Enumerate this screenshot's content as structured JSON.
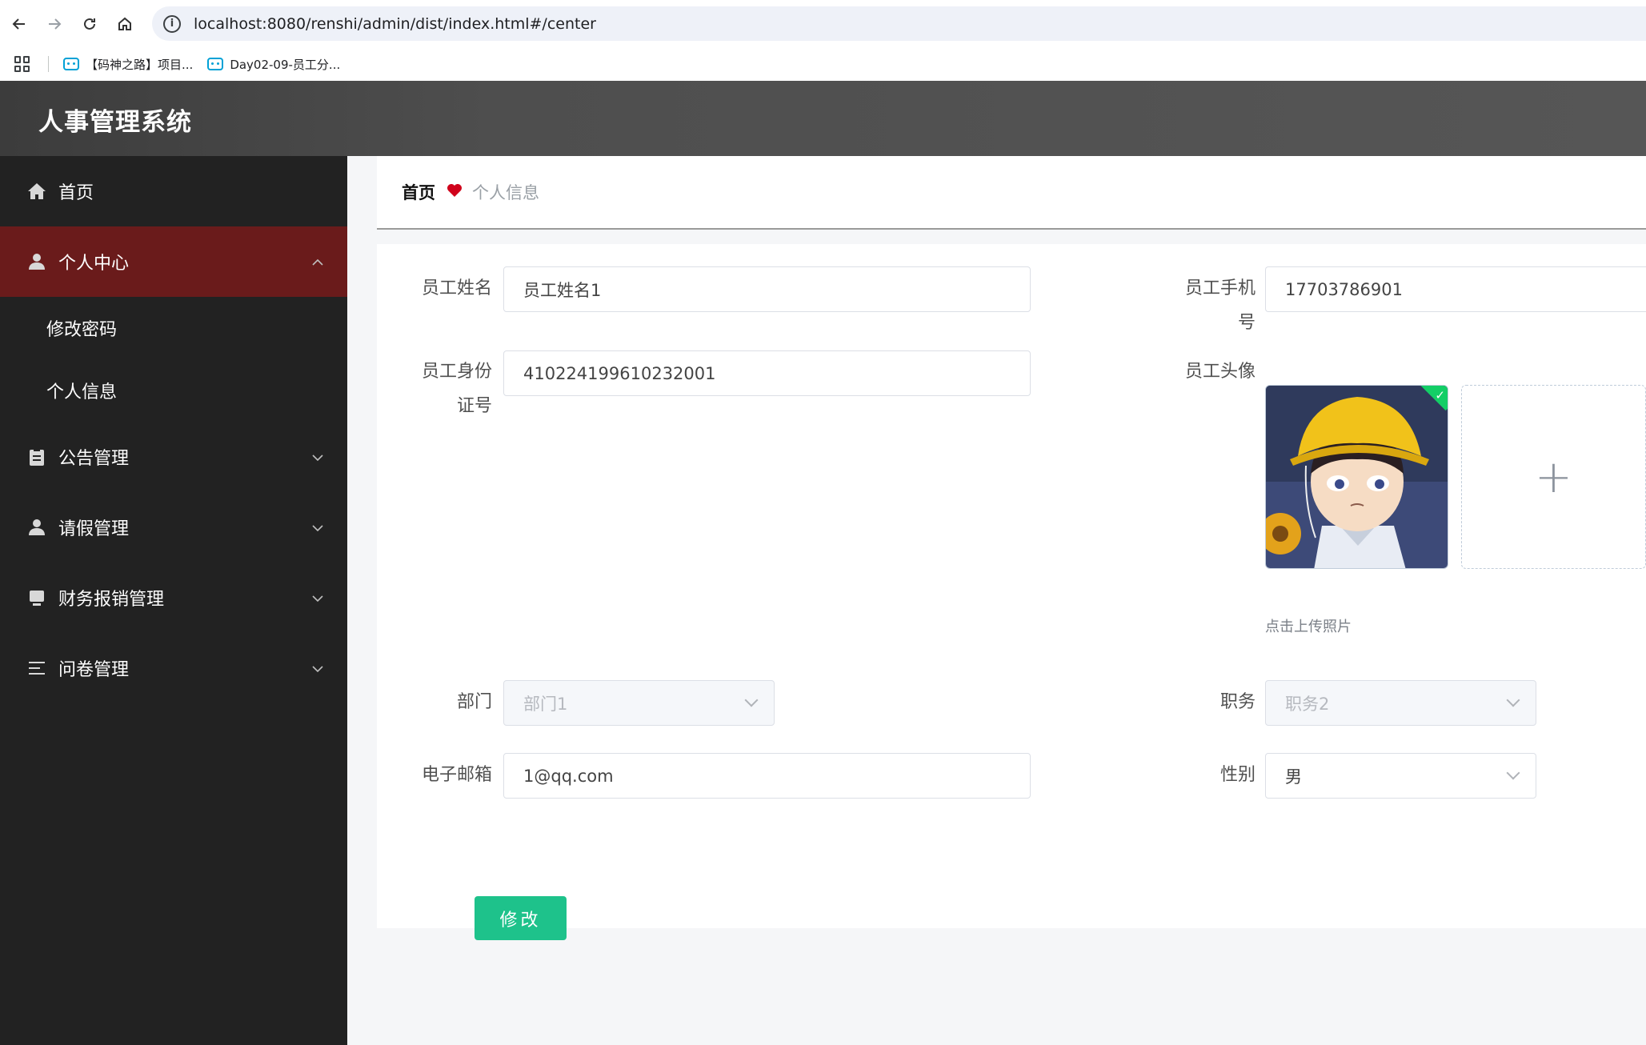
{
  "browser": {
    "url": "localhost:8080/renshi/admin/dist/index.html#/center",
    "bookmarks": [
      "【码神之路】项目...",
      "Day02-09-员工分..."
    ]
  },
  "app": {
    "title": "人事管理系统"
  },
  "sidebar": {
    "items": [
      {
        "label": "首页",
        "icon": "home-icon"
      },
      {
        "label": "个人中心",
        "icon": "user-icon",
        "expanded": true
      },
      {
        "label": "修改密码"
      },
      {
        "label": "个人信息"
      },
      {
        "label": "公告管理",
        "icon": "clipboard-icon"
      },
      {
        "label": "请假管理",
        "icon": "user-icon"
      },
      {
        "label": "财务报销管理",
        "icon": "monitor-icon"
      },
      {
        "label": "问卷管理",
        "icon": "list-icon"
      }
    ]
  },
  "breadcrumb": {
    "home": "首页",
    "current": "个人信息"
  },
  "form": {
    "name_label": "员工姓名",
    "name_value": "员工姓名1",
    "phone_label_1": "员工手机",
    "phone_label_2": "号",
    "phone_value": "17703786901",
    "idcard_label_1": "员工身份",
    "idcard_label_2": "证号",
    "idcard_value": "410224199610232001",
    "avatar_label": "员工头像",
    "upload_plus": "+",
    "upload_tip": "点击上传照片",
    "dept_label": "部门",
    "dept_value": "部门1",
    "position_label": "职务",
    "position_value": "职务2",
    "email_label": "电子邮箱",
    "email_value": "1@qq.com",
    "gender_label": "性别",
    "gender_value": "男",
    "submit_label": "修改"
  },
  "colors": {
    "sidebar_bg": "#222222",
    "active_menu": "#6a1b1b",
    "header_bg": "#4e4e4e",
    "accent_button": "#1ec28b"
  }
}
